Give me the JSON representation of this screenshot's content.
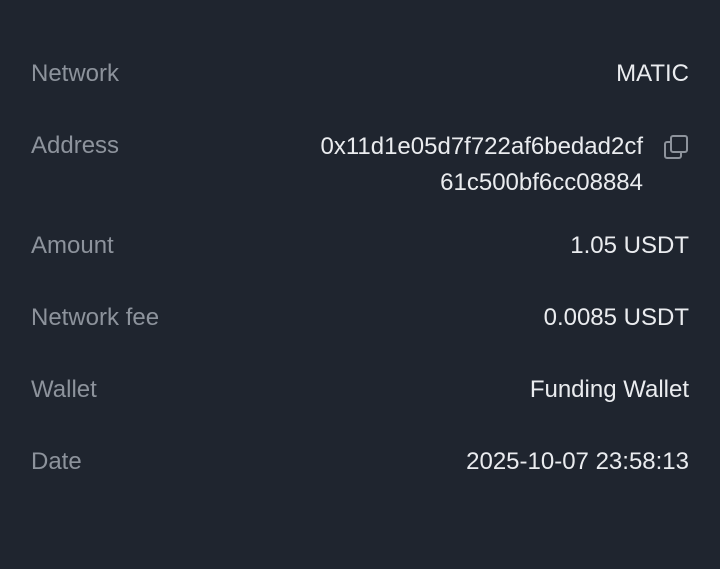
{
  "details": {
    "network": {
      "label": "Network",
      "value": "MATIC"
    },
    "address": {
      "label": "Address",
      "line1": "0x11d1e05d7f722af6bedad2cf",
      "line2": "61c500bf6cc08884",
      "copy_icon": "copy-icon"
    },
    "amount": {
      "label": "Amount",
      "value": "1.05 USDT"
    },
    "network_fee": {
      "label": "Network fee",
      "value": "0.0085 USDT"
    },
    "wallet": {
      "label": "Wallet",
      "value": "Funding Wallet"
    },
    "date": {
      "label": "Date",
      "value": "2025-10-07 23:58:13"
    }
  },
  "colors": {
    "background": "#1f252f",
    "label": "#8d939c",
    "value": "#eaecef"
  }
}
